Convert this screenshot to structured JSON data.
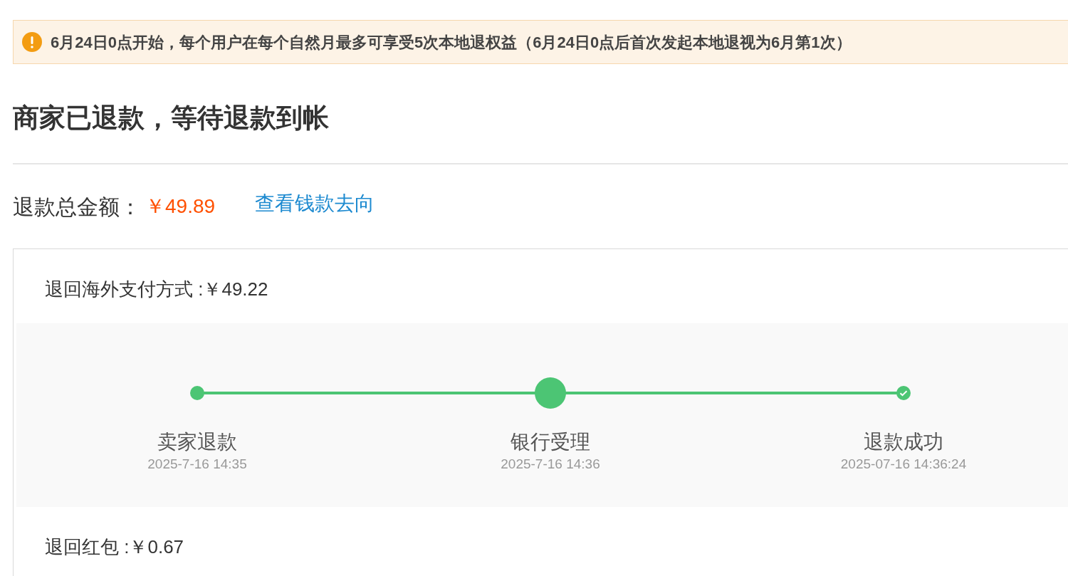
{
  "notice": {
    "text": "6月24日0点开始，每个用户在每个自然月最多可享受5次本地退权益（6月24日0点后首次发起本地退视为6月第1次）"
  },
  "status_title": "商家已退款，等待退款到帐",
  "refund_total": {
    "label": "退款总金额：",
    "amount": "￥49.89",
    "link": "查看钱款去向"
  },
  "refund_overseas": {
    "label": "退回海外支付方式 :￥49.22",
    "steps": [
      {
        "kind": "dot",
        "label": "卖家退款",
        "time": "2025-7-16 14:35"
      },
      {
        "kind": "current",
        "label": "银行受理",
        "time": "2025-7-16 14:36"
      },
      {
        "kind": "check",
        "label": "退款成功",
        "time": "2025-07-16 14:36:24"
      }
    ]
  },
  "refund_redpacket": {
    "label": "退回红包 :￥0.67"
  }
}
